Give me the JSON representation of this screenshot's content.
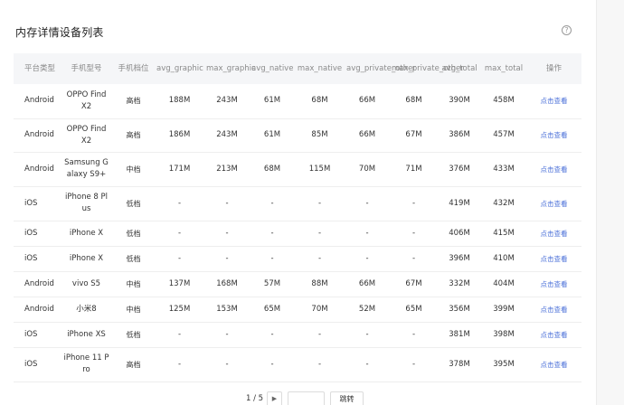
{
  "title": "内存详情设备列表",
  "help_icon": "?",
  "columns": [
    "平台类型",
    "手机型号",
    "手机档位",
    "avg_graphic",
    "max_graphic",
    "avg_native",
    "max_native",
    "avg_private_other",
    "max_private_other",
    "avg_total",
    "max_total",
    "操作"
  ],
  "rows": [
    [
      "Android",
      "OPPO Find X2",
      "高档",
      "188M",
      "243M",
      "61M",
      "68M",
      "66M",
      "68M",
      "390M",
      "458M",
      "点击查看"
    ],
    [
      "Android",
      "OPPO Find X2",
      "高档",
      "186M",
      "243M",
      "61M",
      "85M",
      "66M",
      "67M",
      "386M",
      "457M",
      "点击查看"
    ],
    [
      "Android",
      "Samsung Galaxy S9+",
      "中档",
      "171M",
      "213M",
      "68M",
      "115M",
      "70M",
      "71M",
      "376M",
      "433M",
      "点击查看"
    ],
    [
      "iOS",
      "iPhone 8 Plus",
      "低档",
      "-",
      "-",
      "-",
      "-",
      "-",
      "-",
      "419M",
      "432M",
      "点击查看"
    ],
    [
      "iOS",
      "iPhone X",
      "低档",
      "-",
      "-",
      "-",
      "-",
      "-",
      "-",
      "406M",
      "415M",
      "点击查看"
    ],
    [
      "iOS",
      "iPhone X",
      "低档",
      "-",
      "-",
      "-",
      "-",
      "-",
      "-",
      "396M",
      "410M",
      "点击查看"
    ],
    [
      "Android",
      "vivo S5",
      "中档",
      "137M",
      "168M",
      "57M",
      "88M",
      "66M",
      "67M",
      "332M",
      "404M",
      "点击查看"
    ],
    [
      "Android",
      "小米8",
      "中档",
      "125M",
      "153M",
      "65M",
      "70M",
      "52M",
      "65M",
      "356M",
      "399M",
      "点击查看"
    ],
    [
      "iOS",
      "iPhone XS",
      "低档",
      "-",
      "-",
      "-",
      "-",
      "-",
      "-",
      "381M",
      "398M",
      "点击查看"
    ],
    [
      "iOS",
      "iPhone 11 Pro",
      "高档",
      "-",
      "-",
      "-",
      "-",
      "-",
      "-",
      "378M",
      "395M",
      "点击查看"
    ]
  ],
  "pagination": {
    "info": "1 / 5",
    "next_icon": "▶",
    "jump_input_value": "",
    "jump_label": "跳转"
  },
  "colors": {
    "header_bg": "#f5f6f8",
    "link": "#4a6fd8",
    "border": "#eeeeee"
  }
}
